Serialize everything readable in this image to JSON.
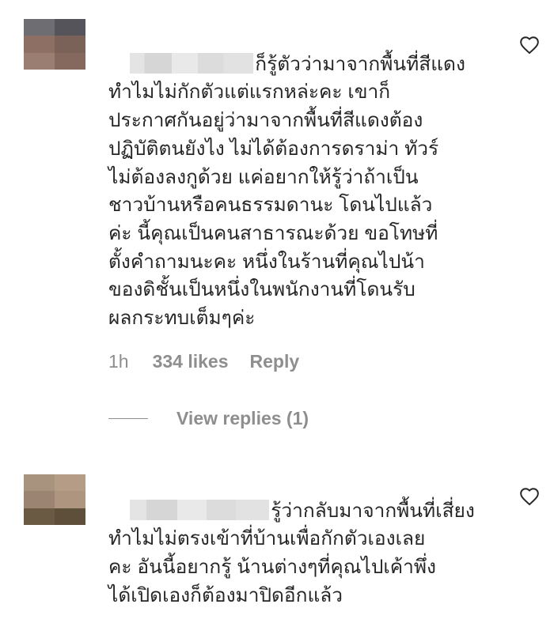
{
  "comments": [
    {
      "text": "ก็รู้ตัวว่ามาจากพื้นที่สีแดง\nทำไมไม่กักตัวแต่แรกหล่ะคะ เขาก็\nประกาศกันอยู่ว่ามาจากพื้นที่สีแดงต้อง\nปฏิบัติตนยังไง ไม่ได้ต้องการดราม่า ทัวร์\nไม่ต้องลงกูด้วย แค่อยากให้รู้ว่าถ้าเป็น\nชาวบ้านหรือคนธรรมดานะ โดนไปแล้ว\nค่ะ นี้คุณเป็นคนสาธารณะด้วย ขอโทษที่\nตั้งคำถามนะคะ หนึ่งในร้านที่คุณไปน้า\nของดิชั้นเป็นหนึ่งในพนักงานที่โดนรับ\nผลกระทบเต็มๆค่ะ",
      "time": "1h",
      "likes": "334 likes",
      "reply_label": "Reply",
      "view_replies_label": "View replies (1)",
      "icon": "heart-outline-icon"
    },
    {
      "text": "รู้ว่ากลับมาจากพื้นที่เสี่ยง\nทำไมไม่ตรงเข้าที่บ้านเพื่อกักตัวเองเลย\nคะ อันนี้อยากรู้ น้านต่างๆที่คุณไปเค้าพึ่ง\nได้เปิดเองก็ต้องมาปิดอีกแล้ว",
      "icon": "heart-outline-icon"
    }
  ],
  "colors": {
    "text": "#262626",
    "meta": "#8e8e8e",
    "background": "#ffffff"
  }
}
